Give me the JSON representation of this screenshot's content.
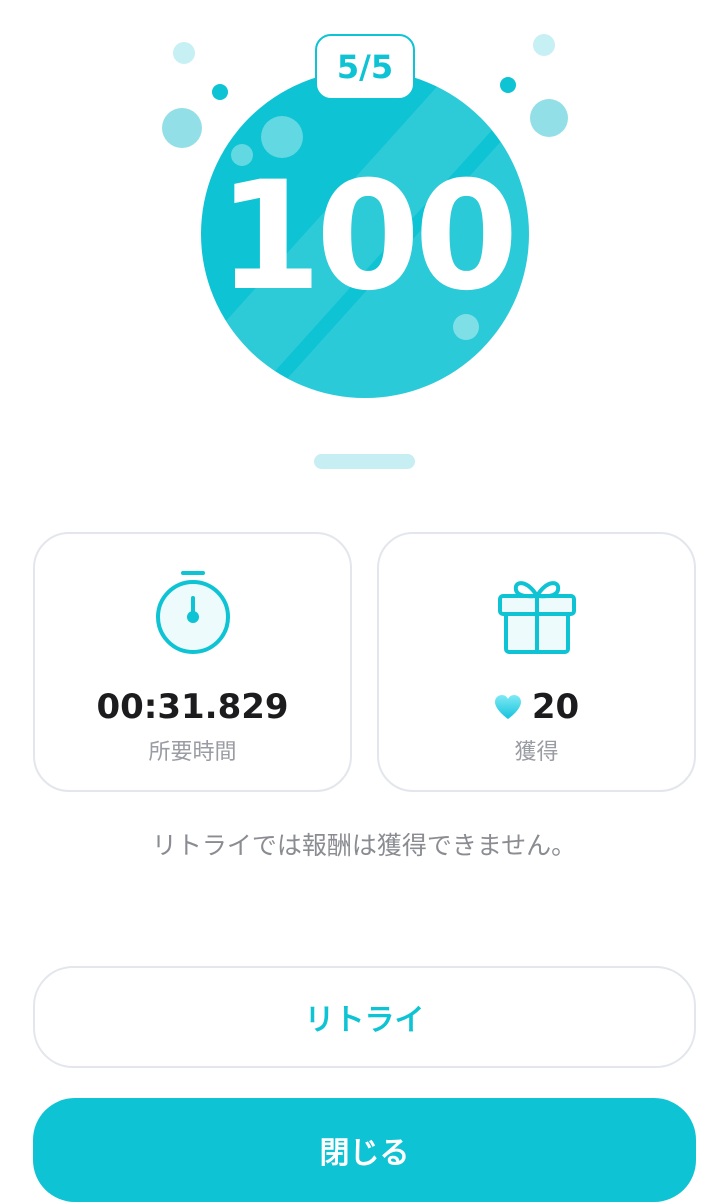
{
  "result": {
    "progress": "5/5",
    "score": "100"
  },
  "stats": {
    "time": {
      "value": "00:31.829",
      "label": "所要時間",
      "icon": "stopwatch-icon"
    },
    "reward": {
      "value": "20",
      "label": "獲得",
      "icon": "gift-icon",
      "currency_icon": "heart-icon"
    }
  },
  "notice": "リトライでは報酬は獲得できません。",
  "buttons": {
    "retry": "リトライ",
    "close": "閉じる"
  },
  "colors": {
    "accent": "#0ec3d3",
    "card_border": "#e3e6ec",
    "text_dark": "#1c1c1e",
    "text_muted": "#9a9ca3"
  }
}
